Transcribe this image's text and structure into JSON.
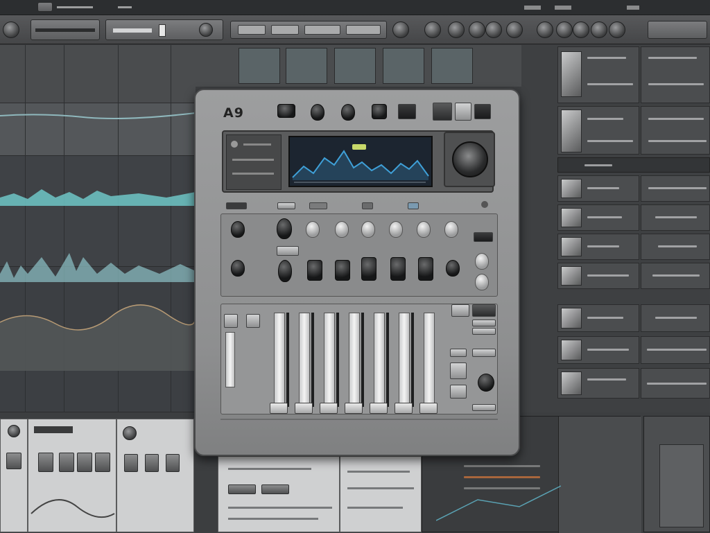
{
  "device": {
    "logo": "A9"
  },
  "colors": {
    "waveform": "#6fc6c7",
    "screen_wave": "#3fa0d8",
    "screen_bg": "#1c2530"
  },
  "icons": [
    "menu-icon",
    "record-icon",
    "play-icon",
    "stop-icon",
    "jog-wheel-icon",
    "settings-icon"
  ]
}
